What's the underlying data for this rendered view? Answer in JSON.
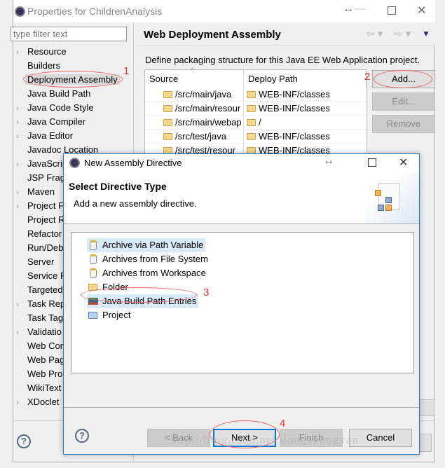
{
  "window": {
    "title": "Properties for ChildrenAnalysis",
    "icon": "eclipse-icon"
  },
  "filter": {
    "placeholder": "type filter text"
  },
  "tree": [
    {
      "label": "Resource",
      "expandable": true
    },
    {
      "label": "Builders",
      "expandable": false
    },
    {
      "label": "Deployment Assembly",
      "expandable": false,
      "selected": true
    },
    {
      "label": "Java Build Path",
      "expandable": false
    },
    {
      "label": "Java Code Style",
      "expandable": true
    },
    {
      "label": "Java Compiler",
      "expandable": true
    },
    {
      "label": "Java Editor",
      "expandable": true
    },
    {
      "label": "Javadoc Location",
      "expandable": false
    },
    {
      "label": "JavaScrip",
      "expandable": true
    },
    {
      "label": "JSP Frag",
      "expandable": false
    },
    {
      "label": "Maven",
      "expandable": true
    },
    {
      "label": "Project F",
      "expandable": true
    },
    {
      "label": "Project R",
      "expandable": false
    },
    {
      "label": "Refactor",
      "expandable": false
    },
    {
      "label": "Run/Deb",
      "expandable": false
    },
    {
      "label": "Server",
      "expandable": false
    },
    {
      "label": "Service P",
      "expandable": false
    },
    {
      "label": "Targeted",
      "expandable": false
    },
    {
      "label": "Task Rep",
      "expandable": true
    },
    {
      "label": "Task Tag",
      "expandable": false
    },
    {
      "label": "Validatio",
      "expandable": true
    },
    {
      "label": "Web Cor",
      "expandable": false
    },
    {
      "label": "Web Pag",
      "expandable": false
    },
    {
      "label": "Web Pro",
      "expandable": false
    },
    {
      "label": "WikiText",
      "expandable": false
    },
    {
      "label": "XDoclet",
      "expandable": true
    }
  ],
  "page": {
    "title": "Web Deployment Assembly",
    "description": "Define packaging structure for this Java EE Web Application project.",
    "columns": [
      "Source",
      "Deploy Path"
    ],
    "rows": [
      {
        "source": "/src/main/java",
        "deploy": "WEB-INF/classes"
      },
      {
        "source": "/src/main/resour",
        "deploy": "WEB-INF/classes"
      },
      {
        "source": "/src/main/webap",
        "deploy": "/"
      },
      {
        "source": "/src/test/java",
        "deploy": "WEB-INF/classes"
      },
      {
        "source": "/src/test/resour",
        "deploy": "WEB-INF/classes"
      }
    ],
    "buttons": {
      "add": "Add...",
      "edit": "Edit...",
      "remove": "Remove"
    }
  },
  "annotations": {
    "a1": "1",
    "a2": "2",
    "a3": "3",
    "a4": "4",
    "color": "#e33333"
  },
  "dialog": {
    "title": "New Assembly Directive",
    "heading": "Select Directive Type",
    "subheading": "Add a new assembly directive.",
    "items": [
      {
        "label": "Archive via Path Variable",
        "icon": "jar-icon"
      },
      {
        "label": "Archives from File System",
        "icon": "jar-icon"
      },
      {
        "label": "Archives from Workspace",
        "icon": "jar-icon"
      },
      {
        "label": "Folder",
        "icon": "folder-icon"
      },
      {
        "label": "Java Build Path Entries",
        "icon": "library-icon"
      },
      {
        "label": "Project",
        "icon": "open-folder-icon"
      }
    ],
    "buttons": {
      "back": "< Back",
      "next": "Next >",
      "finish": "Finish",
      "cancel": "Cancel"
    }
  },
  "watermark": "http://blog.csdn.net/dongzhongyan"
}
